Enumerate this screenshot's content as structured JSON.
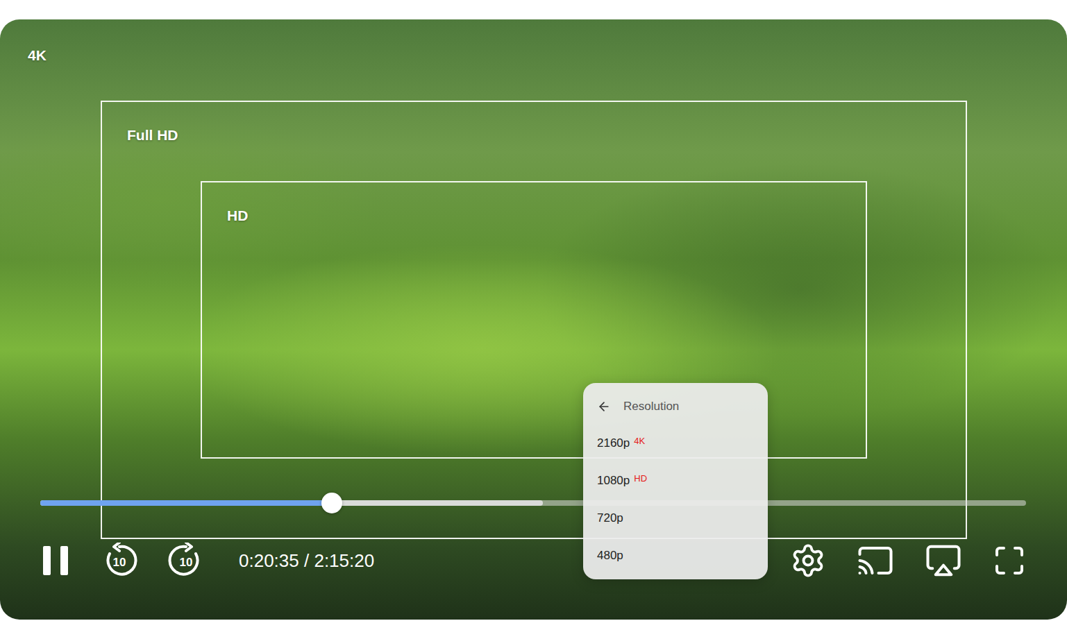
{
  "player": {
    "playing": true,
    "time": "0:20:35 / 2:15:20",
    "skip_back": "10",
    "skip_forward": "10"
  },
  "overlays": [
    {
      "label": "4K",
      "kind": "frame"
    },
    {
      "label": "Full HD",
      "kind": "box"
    },
    {
      "label": "HD",
      "kind": "box"
    }
  ],
  "progress": {
    "level": 0.296,
    "buffered": 0.51
  },
  "resolution_menu": {
    "title": "Resolution",
    "options": [
      {
        "label": "2160p",
        "badge": "4K"
      },
      {
        "label": "1080p",
        "badge": "HD"
      },
      {
        "label": "720p",
        "badge": ""
      },
      {
        "label": "480p",
        "badge": ""
      }
    ]
  }
}
